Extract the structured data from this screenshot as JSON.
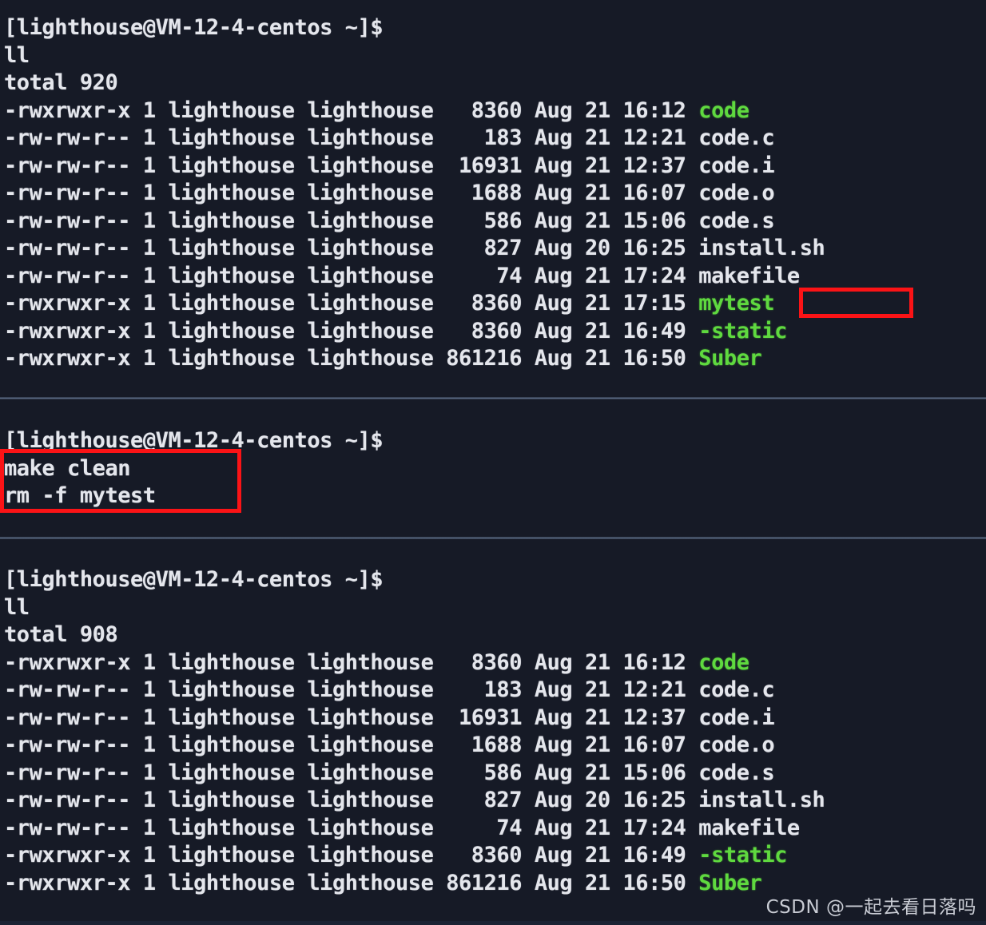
{
  "terminal": {
    "background_color": "#161a26",
    "text_color": "#e4e6ec",
    "executable_color": "#5fd93f",
    "annotation_color": "#fb1316",
    "prompt": "[lighthouse@VM-12-4-centos ~]$",
    "user": "lighthouse",
    "host": "VM-12-4-centos",
    "cwd": "~"
  },
  "sections": {
    "first_listing": {
      "prompt": "[lighthouse@VM-12-4-centos ~]$",
      "command": "ll",
      "total_line": "total 920",
      "total": "920",
      "entries": [
        {
          "perms": "-rwxrwxr-x",
          "links": "1",
          "owner": "lighthouse",
          "group": "lighthouse",
          "size": "8360",
          "month": "Aug",
          "day": "21",
          "time": "16:12",
          "name": "code",
          "type": "executable"
        },
        {
          "perms": "-rw-rw-r--",
          "links": "1",
          "owner": "lighthouse",
          "group": "lighthouse",
          "size": "183",
          "month": "Aug",
          "day": "21",
          "time": "12:21",
          "name": "code.c",
          "type": "file"
        },
        {
          "perms": "-rw-rw-r--",
          "links": "1",
          "owner": "lighthouse",
          "group": "lighthouse",
          "size": "16931",
          "month": "Aug",
          "day": "21",
          "time": "12:37",
          "name": "code.i",
          "type": "file"
        },
        {
          "perms": "-rw-rw-r--",
          "links": "1",
          "owner": "lighthouse",
          "group": "lighthouse",
          "size": "1688",
          "month": "Aug",
          "day": "21",
          "time": "16:07",
          "name": "code.o",
          "type": "file"
        },
        {
          "perms": "-rw-rw-r--",
          "links": "1",
          "owner": "lighthouse",
          "group": "lighthouse",
          "size": "586",
          "month": "Aug",
          "day": "21",
          "time": "15:06",
          "name": "code.s",
          "type": "file"
        },
        {
          "perms": "-rw-rw-r--",
          "links": "1",
          "owner": "lighthouse",
          "group": "lighthouse",
          "size": "827",
          "month": "Aug",
          "day": "20",
          "time": "16:25",
          "name": "install.sh",
          "type": "file"
        },
        {
          "perms": "-rw-rw-r--",
          "links": "1",
          "owner": "lighthouse",
          "group": "lighthouse",
          "size": "74",
          "month": "Aug",
          "day": "21",
          "time": "17:24",
          "name": "makefile",
          "type": "file"
        },
        {
          "perms": "-rwxrwxr-x",
          "links": "1",
          "owner": "lighthouse",
          "group": "lighthouse",
          "size": "8360",
          "month": "Aug",
          "day": "21",
          "time": "17:15",
          "name": "mytest",
          "type": "executable",
          "highlighted": true
        },
        {
          "perms": "-rwxrwxr-x",
          "links": "1",
          "owner": "lighthouse",
          "group": "lighthouse",
          "size": "8360",
          "month": "Aug",
          "day": "21",
          "time": "16:49",
          "name": "-static",
          "type": "executable"
        },
        {
          "perms": "-rwxrwxr-x",
          "links": "1",
          "owner": "lighthouse",
          "group": "lighthouse",
          "size": "861216",
          "month": "Aug",
          "day": "21",
          "time": "16:50",
          "name": "Suber",
          "type": "executable"
        }
      ]
    },
    "make_clean": {
      "prompt": "[lighthouse@VM-12-4-centos ~]$",
      "command": "make clean",
      "output": "rm -f mytest",
      "highlighted": true
    },
    "second_listing": {
      "prompt": "[lighthouse@VM-12-4-centos ~]$",
      "command": "ll",
      "total_line": "total 908",
      "total": "908",
      "entries": [
        {
          "perms": "-rwxrwxr-x",
          "links": "1",
          "owner": "lighthouse",
          "group": "lighthouse",
          "size": "8360",
          "month": "Aug",
          "day": "21",
          "time": "16:12",
          "name": "code",
          "type": "executable"
        },
        {
          "perms": "-rw-rw-r--",
          "links": "1",
          "owner": "lighthouse",
          "group": "lighthouse",
          "size": "183",
          "month": "Aug",
          "day": "21",
          "time": "12:21",
          "name": "code.c",
          "type": "file"
        },
        {
          "perms": "-rw-rw-r--",
          "links": "1",
          "owner": "lighthouse",
          "group": "lighthouse",
          "size": "16931",
          "month": "Aug",
          "day": "21",
          "time": "12:37",
          "name": "code.i",
          "type": "file"
        },
        {
          "perms": "-rw-rw-r--",
          "links": "1",
          "owner": "lighthouse",
          "group": "lighthouse",
          "size": "1688",
          "month": "Aug",
          "day": "21",
          "time": "16:07",
          "name": "code.o",
          "type": "file"
        },
        {
          "perms": "-rw-rw-r--",
          "links": "1",
          "owner": "lighthouse",
          "group": "lighthouse",
          "size": "586",
          "month": "Aug",
          "day": "21",
          "time": "15:06",
          "name": "code.s",
          "type": "file"
        },
        {
          "perms": "-rw-rw-r--",
          "links": "1",
          "owner": "lighthouse",
          "group": "lighthouse",
          "size": "827",
          "month": "Aug",
          "day": "20",
          "time": "16:25",
          "name": "install.sh",
          "type": "file"
        },
        {
          "perms": "-rw-rw-r--",
          "links": "1",
          "owner": "lighthouse",
          "group": "lighthouse",
          "size": "74",
          "month": "Aug",
          "day": "21",
          "time": "17:24",
          "name": "makefile",
          "type": "file"
        },
        {
          "perms": "-rwxrwxr-x",
          "links": "1",
          "owner": "lighthouse",
          "group": "lighthouse",
          "size": "8360",
          "month": "Aug",
          "day": "21",
          "time": "16:49",
          "name": "-static",
          "type": "executable"
        },
        {
          "perms": "-rwxrwxr-x",
          "links": "1",
          "owner": "lighthouse",
          "group": "lighthouse",
          "size": "861216",
          "month": "Aug",
          "day": "21",
          "time": "16:50",
          "name": "Suber",
          "type": "executable"
        }
      ]
    }
  },
  "watermark": {
    "text": "CSDN @一起去看日落吗"
  }
}
